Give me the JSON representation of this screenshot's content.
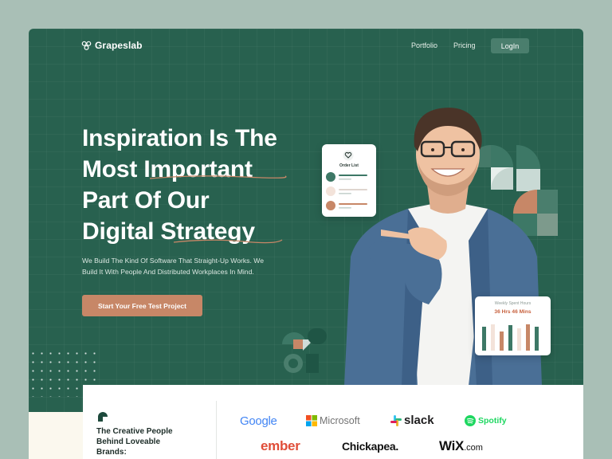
{
  "nav": {
    "logo_text": "Grapeslab",
    "links": [
      "Portfolio",
      "Pricing"
    ],
    "login_label": "LogIn"
  },
  "hero": {
    "headline_lines": [
      "Inspiration Is The",
      "Most Important",
      "Part Of Our",
      "Digital Strategy"
    ],
    "subtext_lines": [
      "We Build The Kind Of Software That Straight-Up Works. We",
      "Build It With People And Distributed Workplaces In Mind."
    ],
    "cta_label": "Start Your Free Test Project"
  },
  "order_card": {
    "title": "Order List"
  },
  "hours_card": {
    "label": "Weekly Spent Hours",
    "value": "36 Hrs 46 Mins"
  },
  "brands_section": {
    "heading_lines": [
      "The Creative People",
      "Behind Loveable",
      "Brands:"
    ],
    "logos": [
      "Google",
      "Microsoft",
      "slack",
      "Spotify",
      "ember",
      "Chickapea.",
      "WiX",
      ".com"
    ]
  },
  "colors": {
    "background": "#a9bfb6",
    "hero_green": "#28614f",
    "accent_terracotta": "#c78767",
    "login_button": "#4a7e6d"
  }
}
